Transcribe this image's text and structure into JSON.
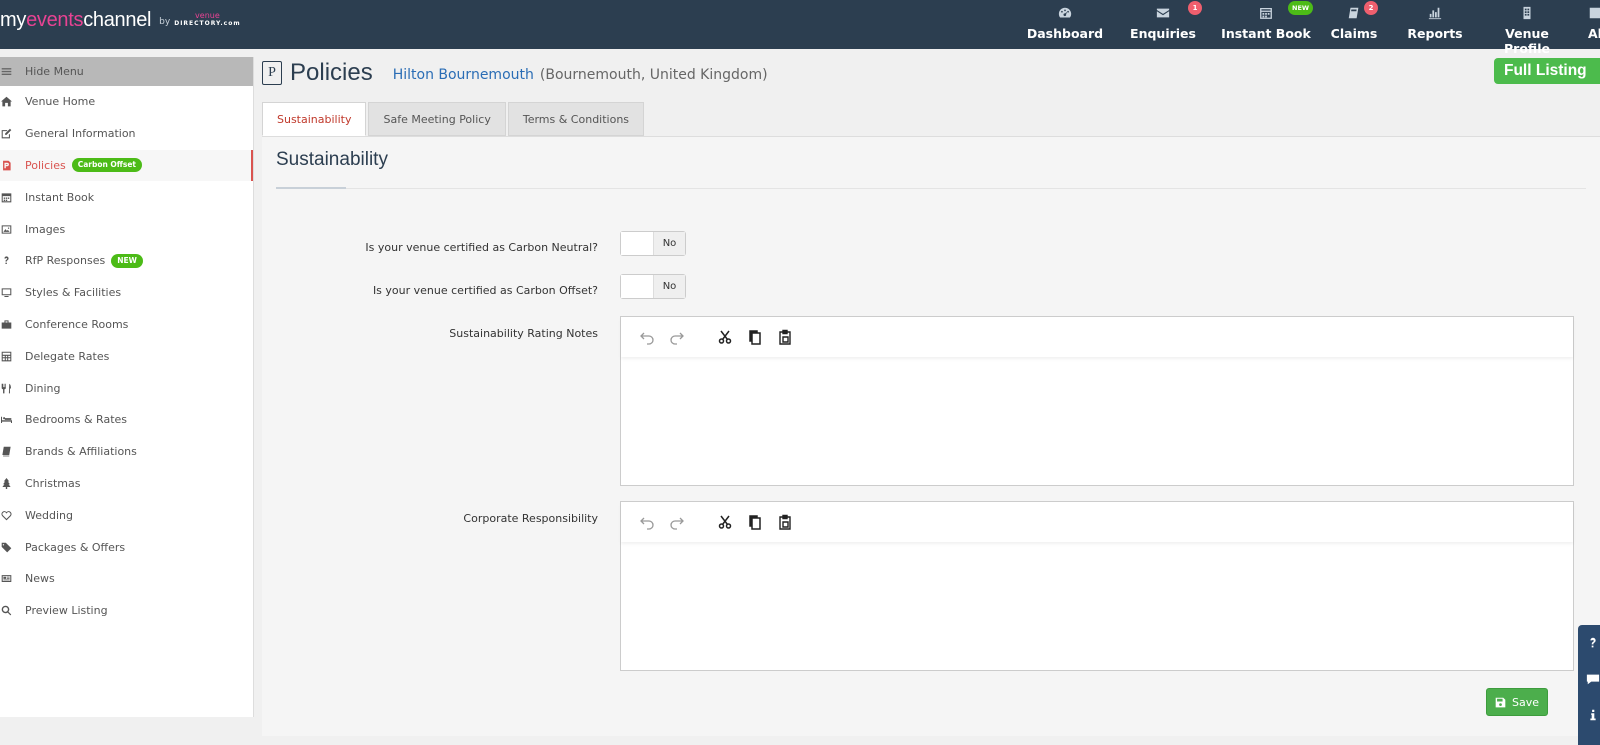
{
  "brand": {
    "my": "my",
    "events": "events",
    "channel": "channel",
    "by": "by",
    "vd_top": "venue",
    "vd_bottom": "DIRECTORY.com"
  },
  "nav": [
    {
      "label": "Dashboard",
      "icon": "gauge-icon",
      "badge": ""
    },
    {
      "label": "Enquiries",
      "icon": "envelope-icon",
      "badge": "1"
    },
    {
      "label": "Instant Book",
      "icon": "calendar-icon",
      "badge": "NEW"
    },
    {
      "label": "Claims",
      "icon": "book-icon",
      "badge": "2"
    },
    {
      "label": "Reports",
      "icon": "bar-chart-icon",
      "badge": ""
    },
    {
      "label": "Venue Profile",
      "icon": "building-icon",
      "badge": ""
    },
    {
      "label": "Al",
      "icon": "partial-icon",
      "badge": ""
    }
  ],
  "sidebar": {
    "hide_menu": "Hide Menu",
    "items": [
      {
        "label": "Venue Home",
        "icon": "home-icon"
      },
      {
        "label": "General Information",
        "icon": "edit-icon"
      },
      {
        "label": "Policies",
        "icon": "policy-icon",
        "pill": "Carbon Offset",
        "active": true
      },
      {
        "label": "Instant Book",
        "icon": "calendar-icon"
      },
      {
        "label": "Images",
        "icon": "image-icon"
      },
      {
        "label": "RfP Responses",
        "icon": "question-icon",
        "pill": "NEW"
      },
      {
        "label": "Styles & Facilities",
        "icon": "monitor-icon"
      },
      {
        "label": "Conference Rooms",
        "icon": "briefcase-icon"
      },
      {
        "label": "Delegate Rates",
        "icon": "calculator-icon"
      },
      {
        "label": "Dining",
        "icon": "cutlery-icon"
      },
      {
        "label": "Bedrooms & Rates",
        "icon": "bed-icon"
      },
      {
        "label": "Brands & Affiliations",
        "icon": "book-icon"
      },
      {
        "label": "Christmas",
        "icon": "tree-icon"
      },
      {
        "label": "Wedding",
        "icon": "heart-icon"
      },
      {
        "label": "Packages & Offers",
        "icon": "tags-icon"
      },
      {
        "label": "News",
        "icon": "newspaper-icon"
      },
      {
        "label": "Preview Listing",
        "icon": "search-icon"
      }
    ]
  },
  "page": {
    "title": "Policies",
    "p_letter": "P",
    "venue_name": "Hilton Bournemouth",
    "venue_location": "(Bournemouth, United Kingdom)",
    "listing_badge": "Full Listing"
  },
  "tabs": [
    {
      "label": "Sustainability",
      "active": true
    },
    {
      "label": "Safe Meeting Policy",
      "active": false
    },
    {
      "label": "Terms & Conditions",
      "active": false
    }
  ],
  "section": {
    "title": "Sustainability",
    "carbon_neutral_label": "Is your venue certified as Carbon Neutral?",
    "carbon_neutral_value": "No",
    "carbon_offset_label": "Is your venue certified as Carbon Offset?",
    "carbon_offset_value": "No",
    "rating_notes_label": "Sustainability Rating Notes",
    "corporate_label": "Corporate Responsibility",
    "save_label": "Save"
  },
  "colors": {
    "topbar": "#2c3e50",
    "accent_red": "#d9534f",
    "green": "#4cbb17",
    "link_blue": "#2a6db5"
  }
}
